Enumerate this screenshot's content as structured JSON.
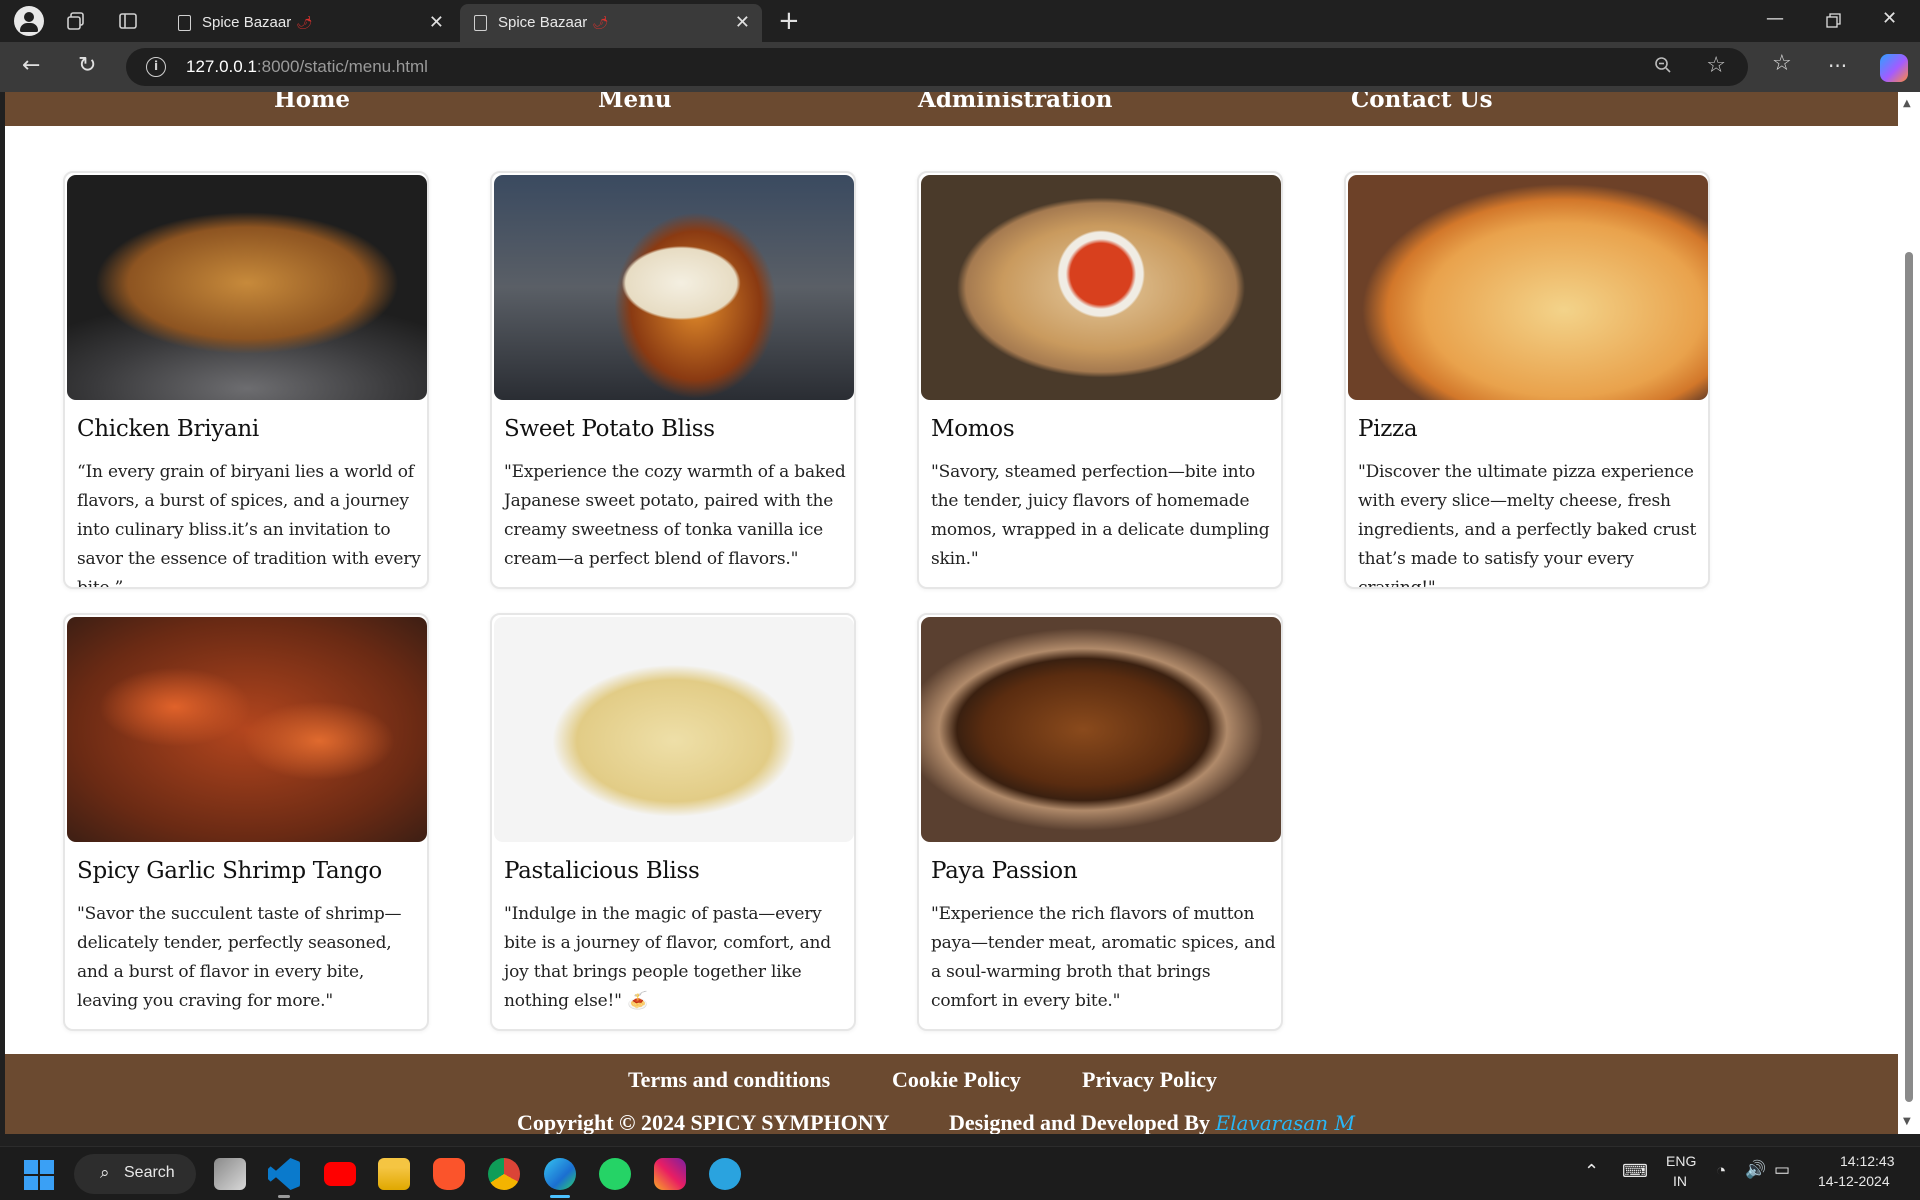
{
  "browser": {
    "tabs": [
      {
        "title": "Spice Bazaar",
        "active": false
      },
      {
        "title": "Spice Bazaar",
        "active": true
      }
    ],
    "url_host": "127.0.0.1",
    "url_path": ":8000/static/menu.html"
  },
  "site": {
    "nav": [
      "Home",
      "Menu",
      "Administration",
      "Contact Us"
    ],
    "dishes": [
      {
        "name": "Chicken Briyani",
        "description": "“In every grain of biryani lies a world of flavors, a burst of spices, and a journey into culinary bliss.it’s an invitation to savor the essence of tradition with every bite.”"
      },
      {
        "name": "Sweet Potato Bliss",
        "description": "\"Experience the cozy warmth of a baked Japanese sweet potato, paired with the creamy sweetness of tonka vanilla ice cream—a perfect blend of flavors.\""
      },
      {
        "name": "Momos",
        "description": "\"Savory, steamed perfection—bite into the tender, juicy flavors of homemade momos, wrapped in a delicate dumpling skin.\""
      },
      {
        "name": "Pizza",
        "description": "\"Discover the ultimate pizza experience with every slice—melty cheese, fresh ingredients, and a perfectly baked crust that’s made to satisfy your every craving!\""
      },
      {
        "name": "Spicy Garlic Shrimp Tango",
        "description": "\"Savor the succulent taste of shrimp—delicately tender, perfectly seasoned, and a burst of flavor in every bite, leaving you craving for more.\""
      },
      {
        "name": "Pastalicious Bliss",
        "description": "\"Indulge in the magic of pasta—every bite is a journey of flavor, comfort, and joy that brings people together like nothing else!\" 🍝"
      },
      {
        "name": "Paya Passion",
        "description": "\"Experience the rich flavors of mutton paya—tender meat, aromatic spices, and a soul-warming broth that brings comfort in every bite.\""
      }
    ],
    "footer": {
      "links": [
        "Terms and conditions",
        "Cookie Policy",
        "Privacy Policy"
      ],
      "copyright": "Copyright © 2024 SPICY SYMPHONY",
      "designed_by": "Designed and Developed By",
      "author": "Elavarasan M"
    },
    "colors": {
      "brand_brown": "#6b4a30",
      "author_link": "#29b6f6"
    }
  },
  "taskbar": {
    "search_label": "Search",
    "lang_top": "ENG",
    "lang_bottom": "IN",
    "time": "14:12:43",
    "date": "14-12-2024"
  }
}
